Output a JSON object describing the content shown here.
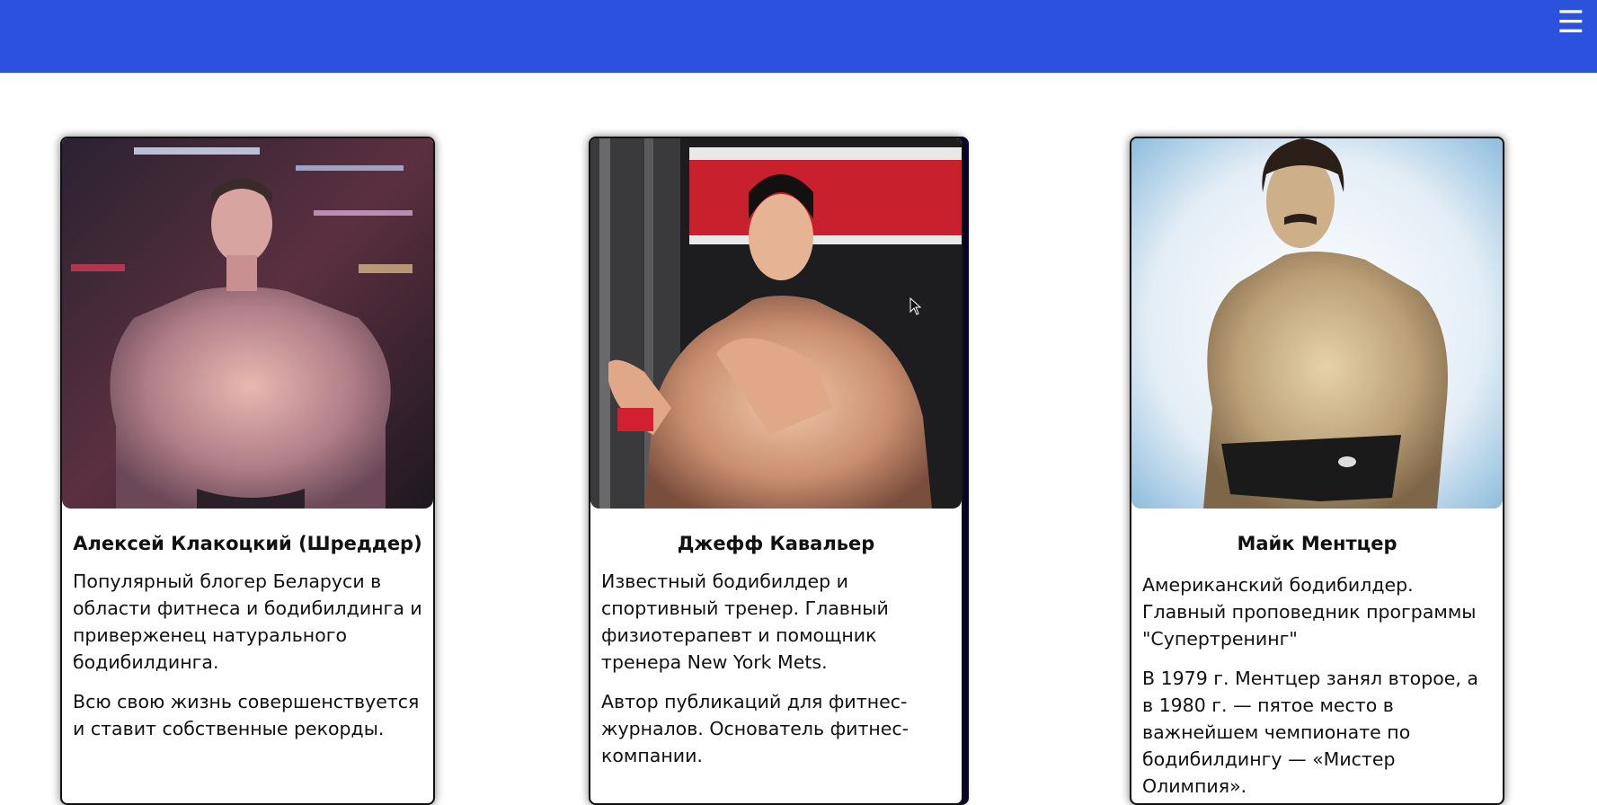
{
  "header": {
    "menu_icon": "hamburger-menu-icon",
    "menu_glyph": "☰",
    "background_color": "#2c51dc"
  },
  "cards": [
    {
      "name": "Алексей Клакоцкий (Шреддер)",
      "paragraphs": [
        "Популярный блогер Беларуси в области фитнеса и бодибилдинга и приверженец натурального бодибилдинга.",
        "Всю свою жизнь совершенствуется и ставит собственные рекорды."
      ]
    },
    {
      "name": "Джефф Кавальер",
      "paragraphs": [
        "Известный бодибилдер и спортивный тренер. Главный физиотерапевт и помощник тренера New York Mets.",
        "Автор публикаций для фитнес-журналов. Основатель фитнес-компании."
      ]
    },
    {
      "name": "Майк Ментцер",
      "paragraphs": [
        "Американский бодибилдер. Главный проповедник программы \"Супертренинг\"",
        "В 1979 г. Ментцер занял второе, а в 1980 г. — пятое место в важнейшем чемпионате по бодибилдингу — «Мистер Олимпия»."
      ]
    }
  ]
}
